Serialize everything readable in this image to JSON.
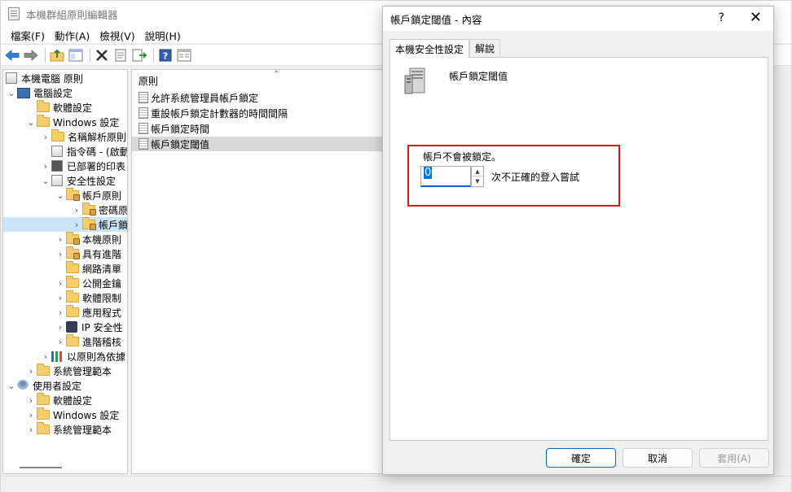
{
  "app": {
    "title": "本機群組原則編輯器"
  },
  "menu": [
    "檔案(F)",
    "動作(A)",
    "檢視(V)",
    "說明(H)"
  ],
  "toolbar": [
    "back-icon",
    "forward-icon",
    "up-folder-icon",
    "show-hide-tree-icon",
    "delete-icon",
    "properties-icon",
    "export-icon",
    "help-icon",
    "extended-view-icon"
  ],
  "tree": {
    "items": [
      {
        "label": "本機電腦 原則",
        "icon": "policy-doc-icon"
      },
      {
        "label": "電腦設定",
        "icon": "computer-icon"
      },
      {
        "label": "軟體設定",
        "icon": "folder-icon"
      },
      {
        "label": "Windows 設定",
        "icon": "folder-icon"
      },
      {
        "label": "名稱解析原則",
        "icon": "folder-icon"
      },
      {
        "label": "指令碼 - (啟動",
        "icon": "script-icon"
      },
      {
        "label": "已部署的印表",
        "icon": "printer-icon"
      },
      {
        "label": "安全性設定",
        "icon": "security-icon"
      },
      {
        "label": "帳戶原則",
        "icon": "folder-lock-icon"
      },
      {
        "label": "密碼原",
        "icon": "folder-lock-icon"
      },
      {
        "label": "帳戶鎖",
        "icon": "folder-lock-icon"
      },
      {
        "label": "本機原則",
        "icon": "folder-lock-icon"
      },
      {
        "label": "具有進階",
        "icon": "folder-lock-icon"
      },
      {
        "label": "網路清單",
        "icon": "folder-icon"
      },
      {
        "label": "公開金鑰",
        "icon": "folder-icon"
      },
      {
        "label": "軟體限制",
        "icon": "folder-icon"
      },
      {
        "label": "應用程式",
        "icon": "folder-icon"
      },
      {
        "label": "IP 安全性",
        "icon": "ip-security-icon"
      },
      {
        "label": "進階稽核",
        "icon": "folder-icon"
      },
      {
        "label": "以原則為依據",
        "icon": "chart-icon"
      },
      {
        "label": "系統管理範本",
        "icon": "folder-icon"
      },
      {
        "label": "使用者設定",
        "icon": "user-icon"
      },
      {
        "label": "軟體設定",
        "icon": "folder-icon"
      },
      {
        "label": "Windows 設定",
        "icon": "folder-icon"
      },
      {
        "label": "系統管理範本",
        "icon": "folder-icon"
      }
    ]
  },
  "list": {
    "column_header": "原則",
    "rows": [
      "允許系統管理員帳戶鎖定",
      "重設帳戶鎖定計數器的時間間隔",
      "帳戶鎖定時間",
      "帳戶鎖定閾值"
    ]
  },
  "dialog": {
    "title": "帳戶鎖定閾值 - 內容",
    "help": "?",
    "close": "✕",
    "tabs": [
      "本機安全性設定",
      "解說"
    ],
    "heading": "帳戶鎖定閾值",
    "setting_label": "帳戶不會被鎖定。",
    "value": "0",
    "suffix": "次不正確的登入嘗試",
    "ok": "確定",
    "cancel": "取消",
    "apply": "套用(A)"
  },
  "colors": {
    "highlight": "#e0141e",
    "accent": "#0078d7"
  }
}
